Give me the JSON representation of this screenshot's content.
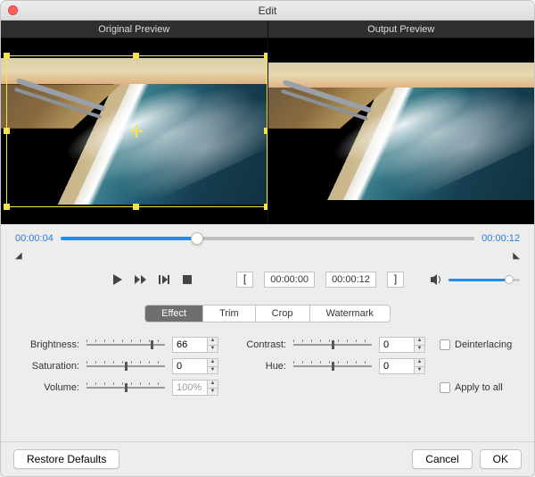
{
  "window": {
    "title": "Edit"
  },
  "previews": {
    "original_label": "Original Preview",
    "output_label": "Output Preview"
  },
  "timeline": {
    "current": "00:00:04",
    "duration": "00:00:12",
    "progress_pct": 33,
    "in_point": "00:00:00",
    "out_point": "00:00:12"
  },
  "volume_slider_pct": 85,
  "tabs": {
    "items": [
      "Effect",
      "Trim",
      "Crop",
      "Watermark"
    ],
    "active_index": 0
  },
  "effect": {
    "brightness": {
      "label": "Brightness:",
      "value": "66",
      "slider_pct": 83
    },
    "contrast": {
      "label": "Contrast:",
      "value": "0",
      "slider_pct": 50
    },
    "saturation": {
      "label": "Saturation:",
      "value": "0",
      "slider_pct": 50
    },
    "hue": {
      "label": "Hue:",
      "value": "0",
      "slider_pct": 50
    },
    "volume": {
      "label": "Volume:",
      "value": "100%",
      "slider_pct": 50
    },
    "deinterlacing": {
      "label": "Deinterlacing",
      "checked": false
    },
    "apply_all": {
      "label": "Apply to all",
      "checked": false
    }
  },
  "footer": {
    "restore": "Restore Defaults",
    "cancel": "Cancel",
    "ok": "OK"
  }
}
